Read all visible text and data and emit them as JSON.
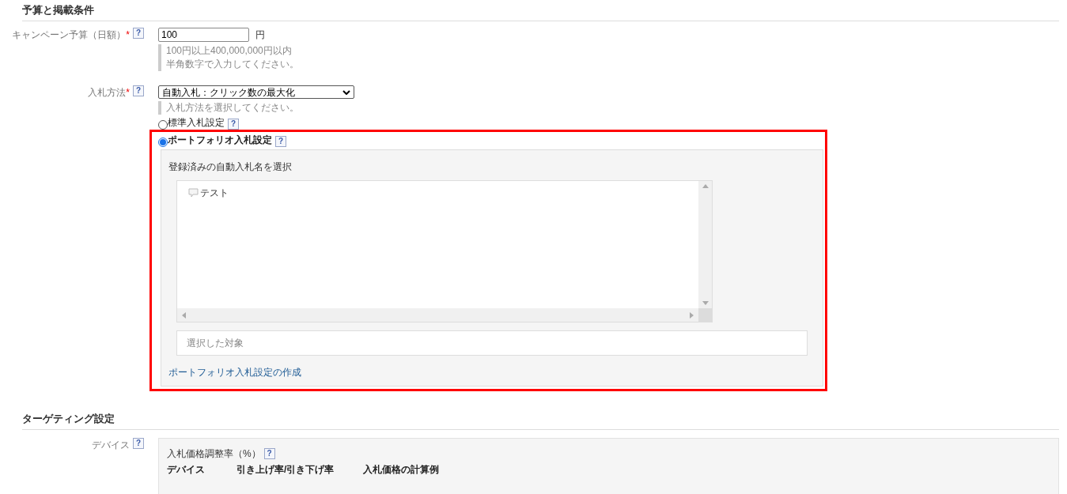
{
  "budget_section": {
    "title": "予算と掲載条件",
    "budget": {
      "label": "キャンペーン予算（日額）",
      "required_mark": "*",
      "help": "?",
      "value": "100",
      "unit": "円",
      "hints": [
        "100円以上400,000,000円以内",
        "半角数字で入力してください。"
      ]
    },
    "bid_method": {
      "label": "入札方法",
      "required_mark": "*",
      "help": "?",
      "value": "自動入札：クリック数の最大化",
      "hint": "入札方法を選択してください。",
      "options": [
        {
          "label": "標準入札設定",
          "help": "?",
          "selected": false
        },
        {
          "label": "ポートフォリオ入札設定",
          "help": "?",
          "selected": true
        }
      ],
      "portfolio": {
        "highlighted": true,
        "list_label": "登録済みの自動入札名を選択",
        "items": [
          {
            "label": "テスト"
          }
        ],
        "selected_placeholder": "選択した対象",
        "create_link": "ポートフォリオ入札設定の作成"
      }
    }
  },
  "targeting_section": {
    "title": "ターゲティング設定",
    "device": {
      "label": "デバイス",
      "help": "?",
      "adjust_label": "入札価格調整率（%）",
      "adjust_help": "?",
      "columns": [
        "デバイス",
        "引き上げ率/引き下げ率",
        "入札価格の計算例"
      ]
    }
  }
}
